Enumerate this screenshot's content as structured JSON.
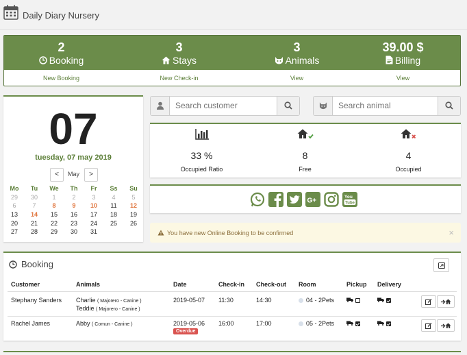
{
  "app": {
    "title": "Daily Diary Nursery"
  },
  "stats": [
    {
      "value": "2",
      "label": "Booking",
      "link": "New Booking",
      "icon": "clock-icon"
    },
    {
      "value": "3",
      "label": "Stays",
      "link": "New Check-in",
      "icon": "home-icon"
    },
    {
      "value": "3",
      "label": "Animals",
      "link": "View",
      "icon": "paw-icon"
    },
    {
      "value": "39.00 $",
      "label": "Billing",
      "link": "View",
      "icon": "file-icon"
    }
  ],
  "calendar": {
    "day": "07",
    "date_text": "tuesday, 07 may 2019",
    "month": "May",
    "prev": "<",
    "next": ">",
    "weekdays": [
      "Mo",
      "Tu",
      "We",
      "Th",
      "Fr",
      "Ss",
      "Su"
    ],
    "weeks": [
      [
        "29",
        "30",
        "1",
        "2",
        "3",
        "4",
        "5"
      ],
      [
        "6",
        "7",
        "8",
        "9",
        "10",
        "11",
        "12"
      ],
      [
        "13",
        "14",
        "15",
        "16",
        "17",
        "18",
        "19"
      ],
      [
        "20",
        "21",
        "22",
        "23",
        "24",
        "25",
        "26"
      ],
      [
        "27",
        "28",
        "29",
        "30",
        "31",
        "",
        ""
      ]
    ]
  },
  "search": {
    "customer_placeholder": "Search customer",
    "animal_placeholder": "Search animal"
  },
  "occupancy": [
    {
      "value": "33 %",
      "label": "Occupied Ratio",
      "icon": "bar-chart-icon"
    },
    {
      "value": "8",
      "label": "Free",
      "icon": "house-check-icon"
    },
    {
      "value": "4",
      "label": "Occupied",
      "icon": "house-x-icon"
    }
  ],
  "social": [
    "whatsapp-icon",
    "facebook-icon",
    "twitter-icon",
    "google-plus-icon",
    "instagram-icon",
    "youtube-icon"
  ],
  "alert": {
    "text": "You have new Online Booking to be confirmed",
    "close": "×"
  },
  "booking": {
    "title": "Booking",
    "columns": [
      "Customer",
      "Animals",
      "Date",
      "Check-in",
      "Check-out",
      "Room",
      "Pickup",
      "Delivery"
    ],
    "rows": [
      {
        "customer": "Stephany Sanders",
        "animals": [
          {
            "name": "Charlie",
            "breed": "( Majorero - Canine )"
          },
          {
            "name": "Teddie",
            "breed": "( Majorero - Canine )"
          }
        ],
        "date": "2019-05-07",
        "checkin": "11:30",
        "checkout": "14:30",
        "room": "04 - 2Pets",
        "pickup": false,
        "delivery": true
      },
      {
        "customer": "Rachel James",
        "animals": [
          {
            "name": "Abby",
            "breed": "( Comun - Canine )"
          }
        ],
        "date": "2019-05-06",
        "badge": "Overdue",
        "checkin": "16:00",
        "checkout": "17:00",
        "room": "05 - 2Pets",
        "pickup": true,
        "delivery": true
      }
    ]
  },
  "colors": {
    "accent": "#6b8c4a",
    "accent_dark": "#5b7e37",
    "highlight": "#e0733a",
    "danger": "#d9534f"
  }
}
